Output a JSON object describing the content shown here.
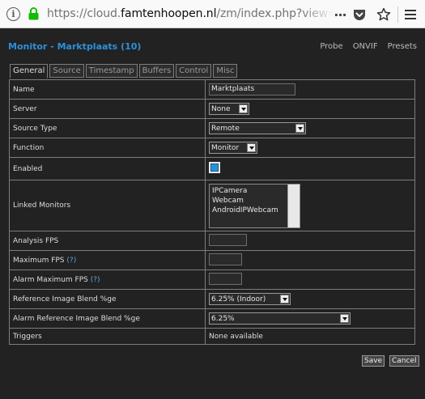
{
  "browser": {
    "url_prefix": "https://cloud.",
    "url_host": "famtenhoopen.nl",
    "url_suffix": "/zm/index.php?view=mor",
    "info_glyph": "i",
    "overflow_glyph": "···",
    "icons": [
      "info-icon",
      "lock-icon",
      "page-actions-icon",
      "pocket-icon",
      "bookmark-star-icon",
      "hamburger-menu-icon"
    ]
  },
  "page": {
    "title": "Monitor - Marktplaats (10)",
    "links": [
      "Probe",
      "ONVIF",
      "Presets"
    ]
  },
  "tabs": [
    {
      "label": "General",
      "active": true
    },
    {
      "label": "Source",
      "active": false
    },
    {
      "label": "Timestamp",
      "active": false
    },
    {
      "label": "Buffers",
      "active": false
    },
    {
      "label": "Control",
      "active": false
    },
    {
      "label": "Misc",
      "active": false
    }
  ],
  "form": {
    "name": {
      "label": "Name",
      "value": "Marktplaats"
    },
    "server": {
      "label": "Server",
      "value": "None"
    },
    "source_type": {
      "label": "Source Type",
      "value": "Remote"
    },
    "function": {
      "label": "Function",
      "value": "Monitor"
    },
    "enabled": {
      "label": "Enabled",
      "checked": true
    },
    "linked_monitors": {
      "label": "Linked Monitors",
      "options": [
        "IPCamera",
        "Webcam",
        "AndroidIPWebcam"
      ]
    },
    "analysis_fps": {
      "label": "Analysis FPS",
      "value": ""
    },
    "maximum_fps": {
      "label": "Maximum FPS",
      "help": "(?)",
      "value": ""
    },
    "alarm_maximum_fps": {
      "label": "Alarm Maximum FPS",
      "help": "(?)",
      "value": ""
    },
    "ref_blend": {
      "label": "Reference Image Blend %ge",
      "value": "6.25% (Indoor)"
    },
    "alarm_ref_blend": {
      "label": "Alarm Reference Image Blend %ge",
      "value": "6.25%"
    },
    "triggers": {
      "label": "Triggers",
      "value": "None available"
    }
  },
  "buttons": {
    "save": "Save",
    "cancel": "Cancel"
  },
  "colors": {
    "accent": "#2b90d9",
    "background": "#222222",
    "border": "#7d7d7d"
  }
}
